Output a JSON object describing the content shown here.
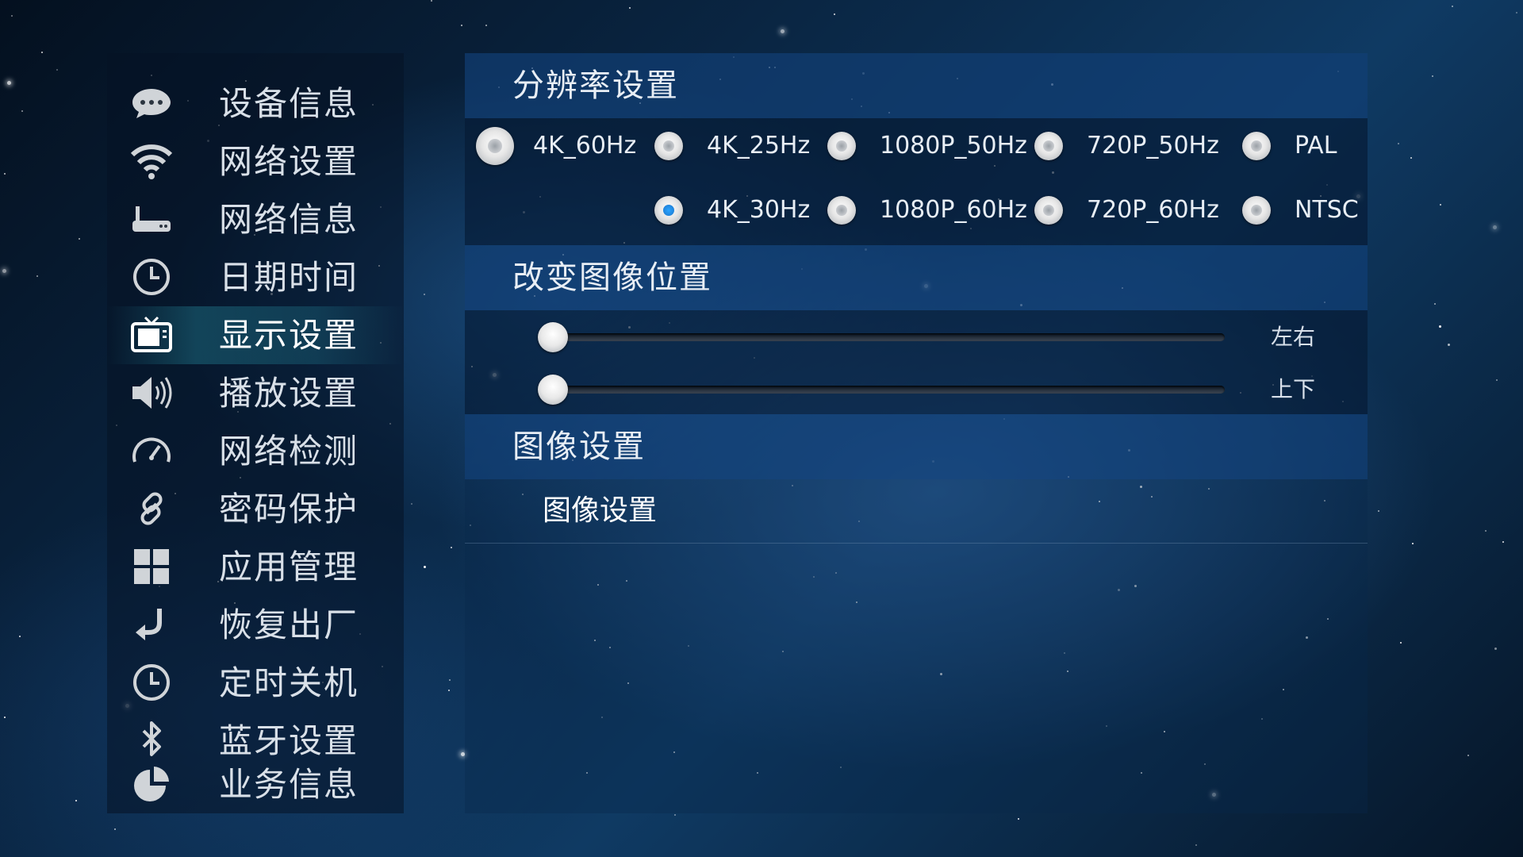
{
  "sidebar": {
    "items": [
      {
        "label": "设备信息",
        "icon": "chat-bubble-icon"
      },
      {
        "label": "网络设置",
        "icon": "wifi-icon"
      },
      {
        "label": "网络信息",
        "icon": "router-icon"
      },
      {
        "label": "日期时间",
        "icon": "clock-icon"
      },
      {
        "label": "显示设置",
        "icon": "tv-icon",
        "active": true
      },
      {
        "label": "播放设置",
        "icon": "speaker-icon"
      },
      {
        "label": "网络检测",
        "icon": "speedometer-icon"
      },
      {
        "label": "密码保护",
        "icon": "link-icon"
      },
      {
        "label": "应用管理",
        "icon": "grid-icon"
      },
      {
        "label": "恢复出厂",
        "icon": "return-arrow-icon"
      },
      {
        "label": "定时关机",
        "icon": "clock-icon"
      },
      {
        "label": "蓝牙设置",
        "icon": "bluetooth-icon"
      },
      {
        "label": "业务信息",
        "icon": "pie-chart-icon"
      }
    ]
  },
  "resolution": {
    "title": "分辨率设置",
    "options": [
      {
        "label": "4K_60Hz",
        "selected": false
      },
      {
        "label": "4K_25Hz",
        "selected": false
      },
      {
        "label": "1080P_50Hz",
        "selected": false
      },
      {
        "label": "720P_50Hz",
        "selected": false
      },
      {
        "label": "PAL",
        "selected": false
      },
      {
        "label": "4K_30Hz",
        "selected": true
      },
      {
        "label": "1080P_60Hz",
        "selected": false
      },
      {
        "label": "720P_60Hz",
        "selected": false
      },
      {
        "label": "NTSC",
        "selected": false
      }
    ]
  },
  "position": {
    "title": "改变图像位置",
    "sliders": [
      {
        "label": "左右",
        "value": 0
      },
      {
        "label": "上下",
        "value": 0
      }
    ]
  },
  "image": {
    "title": "图像设置",
    "item_label": "图像设置"
  },
  "colors": {
    "accent": "#2aa4ff",
    "active_highlight": "#2896aa"
  }
}
